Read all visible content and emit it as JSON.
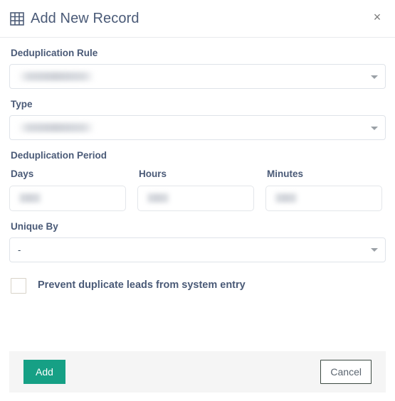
{
  "header": {
    "icon": "table-grid-icon",
    "title": "Add New Record",
    "close_label": "×"
  },
  "form": {
    "deduplication_rule": {
      "label": "Deduplication Rule",
      "value": "",
      "redacted": true
    },
    "type": {
      "label": "Type",
      "value": "",
      "redacted": true
    },
    "deduplication_period": {
      "label": "Deduplication Period",
      "fields": [
        {
          "label": "Days",
          "value": "",
          "redacted": true
        },
        {
          "label": "Hours",
          "value": "",
          "redacted": true
        },
        {
          "label": "Minutes",
          "value": "",
          "redacted": true
        }
      ]
    },
    "unique_by": {
      "label": "Unique By",
      "value": "-"
    },
    "prevent_duplicates": {
      "label": "Prevent duplicate leads from system entry",
      "checked": false
    }
  },
  "footer": {
    "add_label": "Add",
    "cancel_label": "Cancel"
  },
  "colors": {
    "accent_green": "#16a085",
    "label_blue": "#4a5a77",
    "footer_bg": "#f5f5f5",
    "border": "#dfe3e9"
  }
}
